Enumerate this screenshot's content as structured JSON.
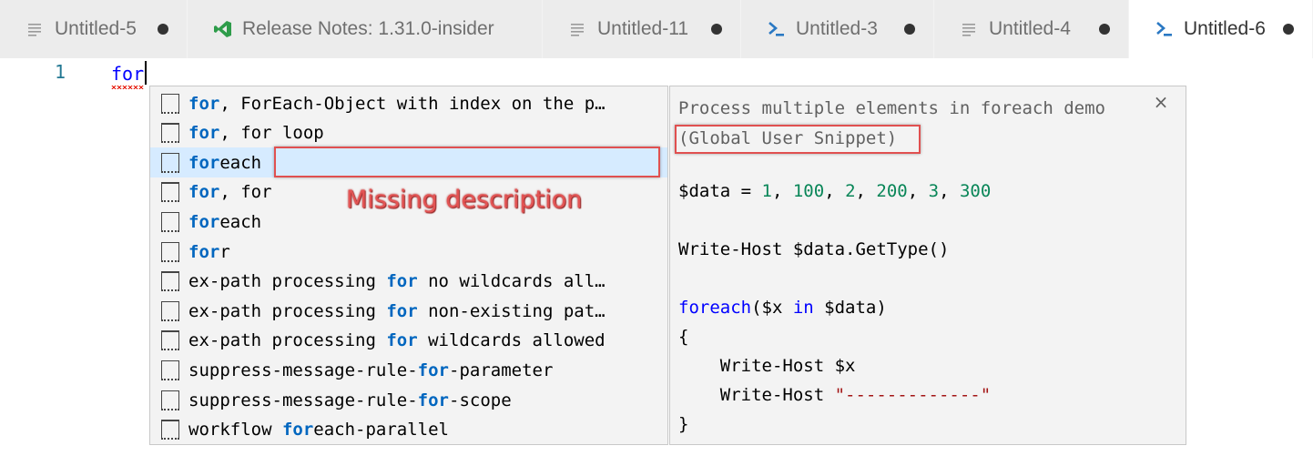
{
  "tabs": [
    {
      "label": "Untitled-5",
      "icon": "lines-icon",
      "dirty": true,
      "active": false
    },
    {
      "label": "Release Notes: 1.31.0-insider",
      "icon": "vscode-icon",
      "dirty": false,
      "active": false
    },
    {
      "label": "Untitled-11",
      "icon": "lines-icon",
      "dirty": true,
      "active": false
    },
    {
      "label": "Untitled-3",
      "icon": "powershell-icon",
      "dirty": true,
      "active": false
    },
    {
      "label": "Untitled-4",
      "icon": "lines-icon",
      "dirty": true,
      "active": false
    },
    {
      "label": "Untitled-6",
      "icon": "powershell-icon",
      "dirty": true,
      "active": true
    }
  ],
  "editor": {
    "line_number": "1",
    "code": "for"
  },
  "suggestions": [
    {
      "match": "for",
      "rest": ", ForEach-Object with index on the p…"
    },
    {
      "match": "for",
      "rest": ", for loop"
    },
    {
      "match": "for",
      "rest": "each"
    },
    {
      "match": "for",
      "rest": ", for"
    },
    {
      "match": "for",
      "rest": "each"
    },
    {
      "match": "for",
      "rest": "r"
    },
    {
      "pre": "ex-path processing ",
      "match": "for",
      "rest": " no wildcards all…"
    },
    {
      "pre": "ex-path processing ",
      "match": "for",
      "rest": " non-existing pat…"
    },
    {
      "pre": "ex-path processing ",
      "match": "for",
      "rest": " wildcards allowed"
    },
    {
      "pre": "suppress-message-rule-",
      "match": "for",
      "rest": "-parameter"
    },
    {
      "pre": "suppress-message-rule-",
      "match": "for",
      "rest": "-scope"
    },
    {
      "pre": "workflow ",
      "match": "for",
      "rest": "each-parallel"
    }
  ],
  "selected_index": 2,
  "details": {
    "title": "Process multiple elements in foreach demo",
    "subtitle": "(Global User Snippet)",
    "close_symbol": "×",
    "code": {
      "line1_var": "$data = ",
      "line1_nums": [
        "1",
        "100",
        "2",
        "200",
        "3",
        "300"
      ],
      "line2": "Write-Host $data.GetType()",
      "line3_kw": "foreach",
      "line3_a": "($x ",
      "line3_in": "in",
      "line3_b": " $data)",
      "line4": "{",
      "line5": "    Write-Host $x",
      "line6_a": "    Write-Host ",
      "line6_str": "\"-------------\"",
      "line7": "}"
    }
  },
  "annotation": {
    "text": "Missing description",
    "color": "#e35454"
  }
}
